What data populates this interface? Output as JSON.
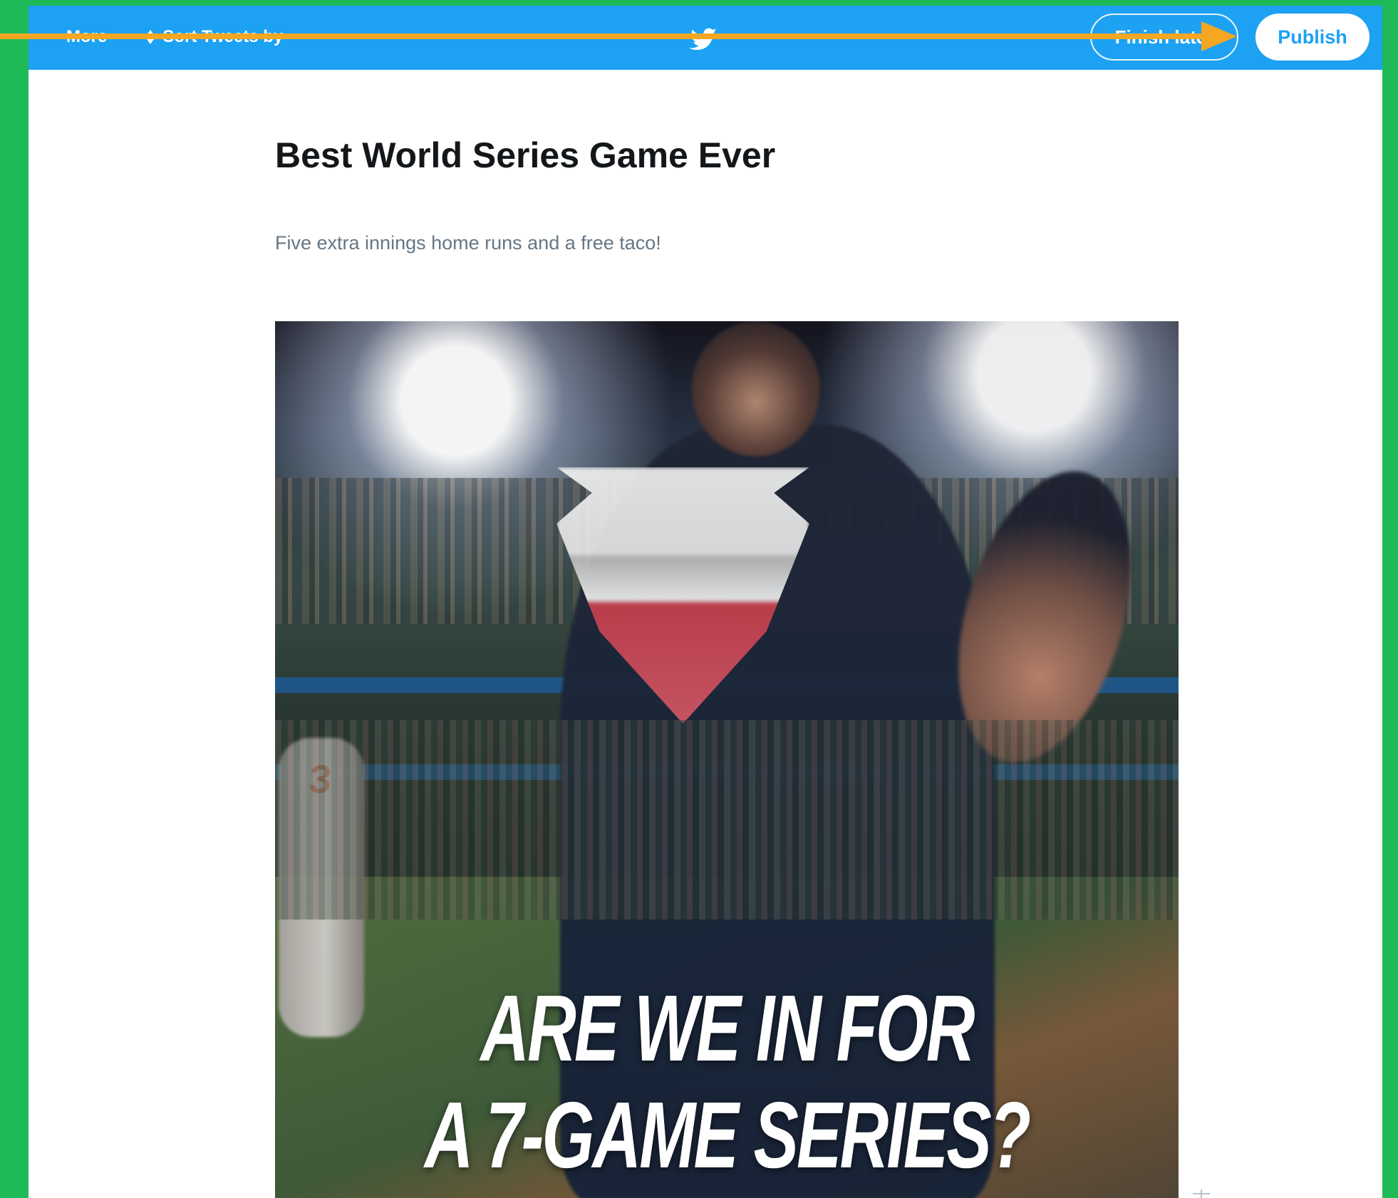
{
  "toolbar": {
    "more_label": "More",
    "sort_label": "Sort Tweets by",
    "finish_later_label": "Finish later",
    "publish_label": "Publish",
    "icons": {
      "more": "dots-icon",
      "sort": "sort-arrows-icon",
      "brand": "twitter-bird-icon"
    }
  },
  "moment": {
    "title": "Best World Series Game Ever",
    "description": "Five extra innings home runs and a free taco!"
  },
  "media": {
    "overlay_line_1": "ARE WE IN FOR",
    "overlay_line_2": "A 7-GAME SERIES?",
    "player_number": "3"
  },
  "colors": {
    "background": "#1fba58",
    "accent": "#1da1f2",
    "annotation_arrow": "#f5a623",
    "title": "#14171a",
    "muted_text": "#657786"
  }
}
